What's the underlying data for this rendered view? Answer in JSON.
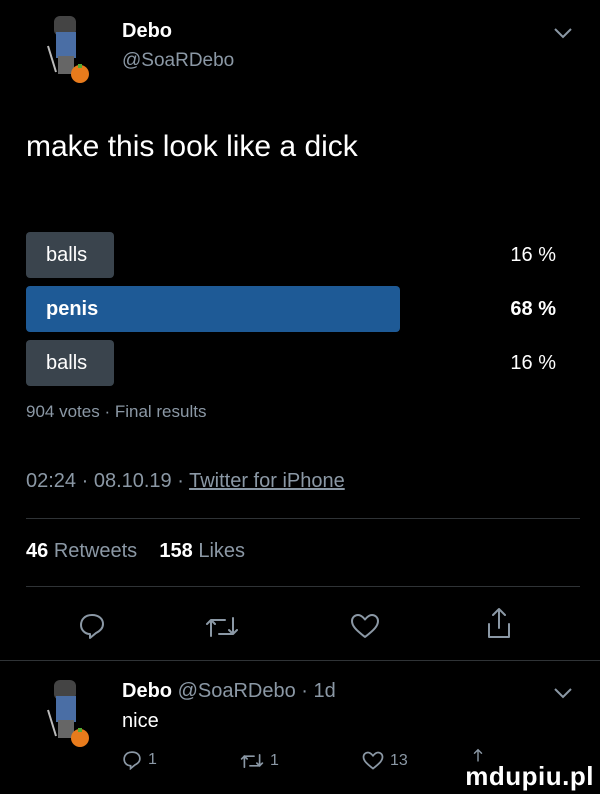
{
  "tweet": {
    "author_name": "Debo",
    "author_handle": "@SoaRDebo",
    "text": "make this look like a dick",
    "poll": {
      "options": [
        {
          "label": "balls",
          "percent_text": "16 %",
          "percent": 16,
          "winner": false
        },
        {
          "label": "penis",
          "percent_text": "68 %",
          "percent": 68,
          "winner": true
        },
        {
          "label": "balls",
          "percent_text": "16 %",
          "percent": 16,
          "winner": false
        }
      ],
      "summary": "904 votes · Final results"
    },
    "time": "02:24 · 08.10.19 · ",
    "source": "Twitter for iPhone",
    "retweets_count": "46",
    "retweets_label": "Retweets",
    "likes_count": "158",
    "likes_label": "Likes"
  },
  "reply": {
    "author_name": "Debo",
    "meta": "@SoaRDebo · 1d",
    "text": "nice",
    "reply_count": "1",
    "retweet_count": "1",
    "like_count": "13"
  },
  "watermark": "mdupiu.pl",
  "colors": {
    "background": "#000000",
    "secondary_text": "#8b98a5",
    "poll_winner": "#1e5a96",
    "poll_other": "#3a444d"
  },
  "icons": [
    "avatar",
    "chevron-down-icon",
    "reply-icon",
    "retweet-icon",
    "like-icon",
    "share-icon"
  ]
}
